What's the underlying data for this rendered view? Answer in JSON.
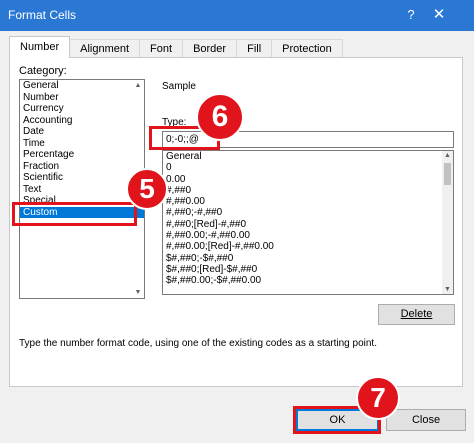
{
  "window": {
    "title": "Format Cells",
    "help_glyph": "?",
    "close_glyph": "✕",
    "titlebar_color": "#2b78d4"
  },
  "tabs": [
    {
      "label": "Number",
      "active": true
    },
    {
      "label": "Alignment"
    },
    {
      "label": "Font"
    },
    {
      "label": "Border"
    },
    {
      "label": "Fill"
    },
    {
      "label": "Protection"
    }
  ],
  "category": {
    "label": "Category:",
    "items": [
      "General",
      "Number",
      "Currency",
      "Accounting",
      "Date",
      "Time",
      "Percentage",
      "Fraction",
      "Scientific",
      "Text",
      "Special",
      "Custom"
    ],
    "selected": "Custom"
  },
  "sample": {
    "label": "Sample"
  },
  "type_field": {
    "label": "Type:",
    "value": "0;-0;;@"
  },
  "format_list": {
    "items": [
      "General",
      "0",
      "0.00",
      "#,##0",
      "#,##0.00",
      "#,##0;-#,##0",
      "#,##0;[Red]-#,##0",
      "#,##0.00;-#,##0.00",
      "#,##0.00;[Red]-#,##0.00",
      "$#,##0;-$#,##0",
      "$#,##0;[Red]-$#,##0",
      "$#,##0.00;-$#,##0.00"
    ]
  },
  "buttons": {
    "delete": "Delete",
    "ok": "OK",
    "close": "Close"
  },
  "hint": "Type the number format code, using one of the existing codes as a starting point.",
  "annotations": {
    "highlight_color": "#e0141a",
    "step_5": "5",
    "step_6": "6",
    "step_7": "7"
  }
}
